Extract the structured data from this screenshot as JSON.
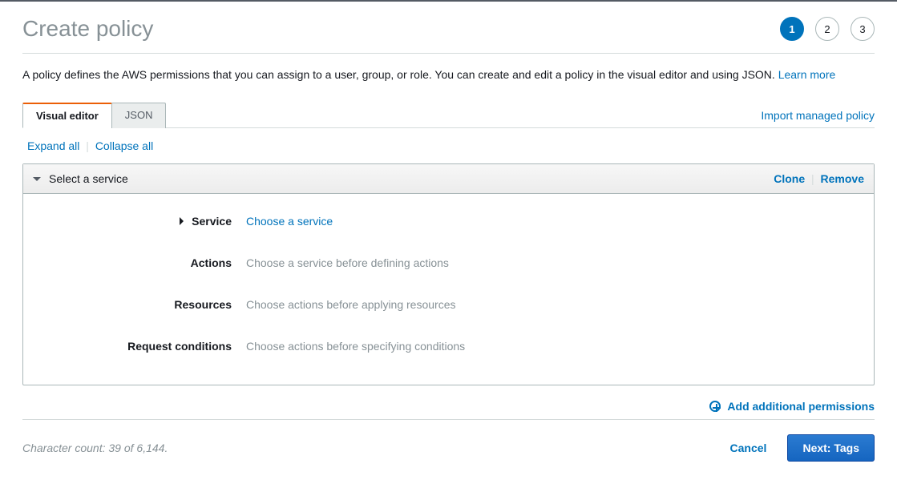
{
  "header": {
    "title": "Create policy",
    "steps": [
      "1",
      "2",
      "3"
    ],
    "active_step_index": 0
  },
  "description": {
    "text": "A policy defines the AWS permissions that you can assign to a user, group, or role. You can create and edit a policy in the visual editor and using JSON. ",
    "learn_more": "Learn more"
  },
  "tabs": {
    "items": [
      "Visual editor",
      "JSON"
    ],
    "active_index": 0,
    "import_link": "Import managed policy"
  },
  "controls": {
    "expand_all": "Expand all",
    "collapse_all": "Collapse all"
  },
  "panel": {
    "title": "Select a service",
    "clone": "Clone",
    "remove": "Remove",
    "rows": {
      "service": {
        "label": "Service",
        "value": "Choose a service",
        "is_link": true
      },
      "actions": {
        "label": "Actions",
        "value": "Choose a service before defining actions",
        "is_link": false
      },
      "resources": {
        "label": "Resources",
        "value": "Choose actions before applying resources",
        "is_link": false
      },
      "conditions": {
        "label": "Request conditions",
        "value": "Choose actions before specifying conditions",
        "is_link": false
      }
    }
  },
  "add_additional": "Add additional permissions",
  "footer": {
    "char_count": "Character count: 39 of 6,144.",
    "cancel": "Cancel",
    "next": "Next: Tags"
  }
}
